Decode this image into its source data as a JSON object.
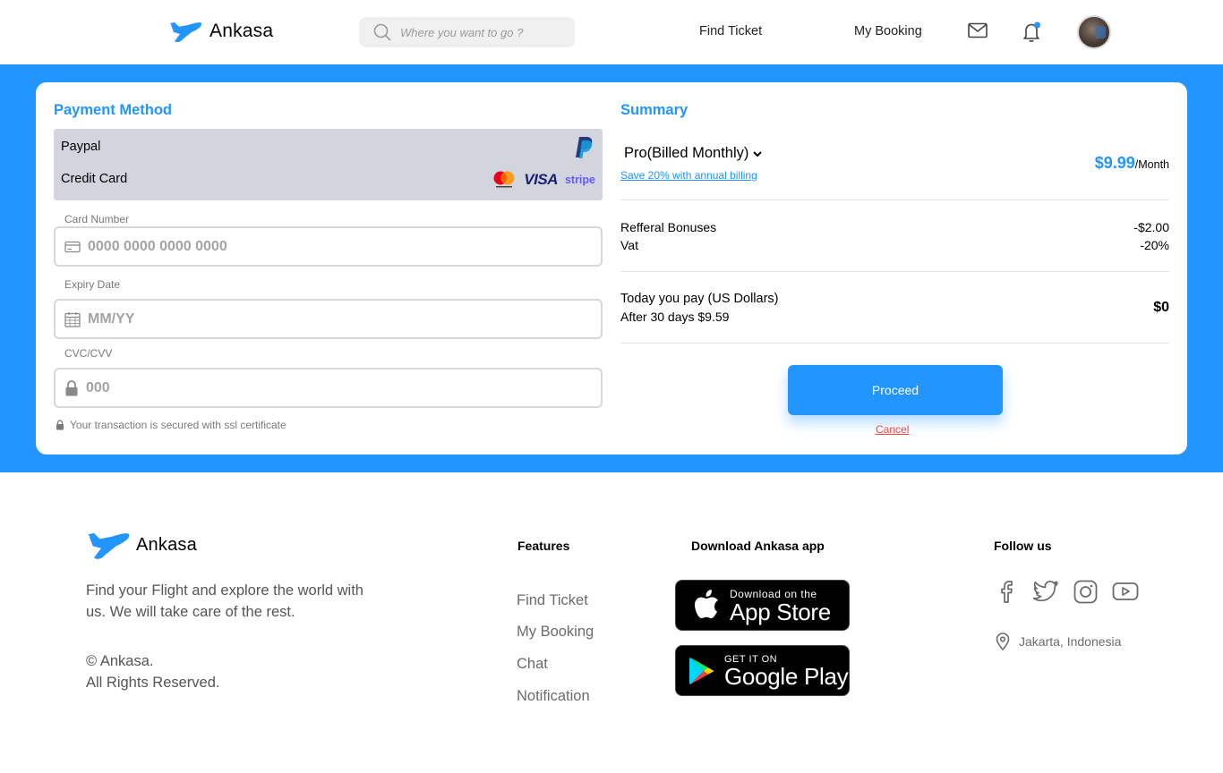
{
  "header": {
    "brand": "Ankasa",
    "search_placeholder": "Where you want to go ?",
    "nav": {
      "find_ticket": "Find Ticket",
      "my_booking": "My Booking"
    }
  },
  "payment": {
    "title": "Payment Method",
    "options": {
      "paypal": "Paypal",
      "credit_card": "Credit Card"
    },
    "fields": {
      "card_number": {
        "label": "Card Number",
        "placeholder": "0000 0000 0000 0000"
      },
      "expiry": {
        "label": "Expiry Date",
        "placeholder": "MM/YY"
      },
      "cvc": {
        "label": "CVC/CVV",
        "placeholder": "000"
      }
    },
    "secure_note": "Your transaction is secured with ssl certificate",
    "brands": {
      "visa": "VISA",
      "stripe": "stripe"
    }
  },
  "summary": {
    "title": "Summary",
    "plan": "Pro(Billed Monthly)",
    "save_link": "Save 20% with annual billing",
    "price": "$9.99",
    "price_period": "/Month",
    "referral_label": "Refferal Bonuses",
    "referral_value": "-$2.00",
    "vat_label": "Vat",
    "vat_value": "-20%",
    "today_label": "Today you pay (US Dollars)",
    "after_label": "After 30 days $9.59",
    "today_value": "$0",
    "proceed": "Proceed",
    "cancel": "Cancel"
  },
  "footer": {
    "brand": "Ankasa",
    "tagline": "Find your Flight and explore the world with us. We will take care of the rest.",
    "copyright_line1": "© Ankasa.",
    "copyright_line2": "All Rights Reserved.",
    "features_title": "Features",
    "features": [
      "Find Ticket",
      "My Booking",
      "Chat",
      "Notification"
    ],
    "download_title": "Download Ankasa app",
    "app_store": {
      "small": "Download on the",
      "big": "App Store"
    },
    "google_play": {
      "small": "GET IT ON",
      "big": "Google Play"
    },
    "follow_title": "Follow us",
    "location": "Jakarta, Indonesia"
  },
  "colors": {
    "primary": "#2395ff",
    "cancel": "#f24545",
    "option_bg": "#d2d5de"
  }
}
